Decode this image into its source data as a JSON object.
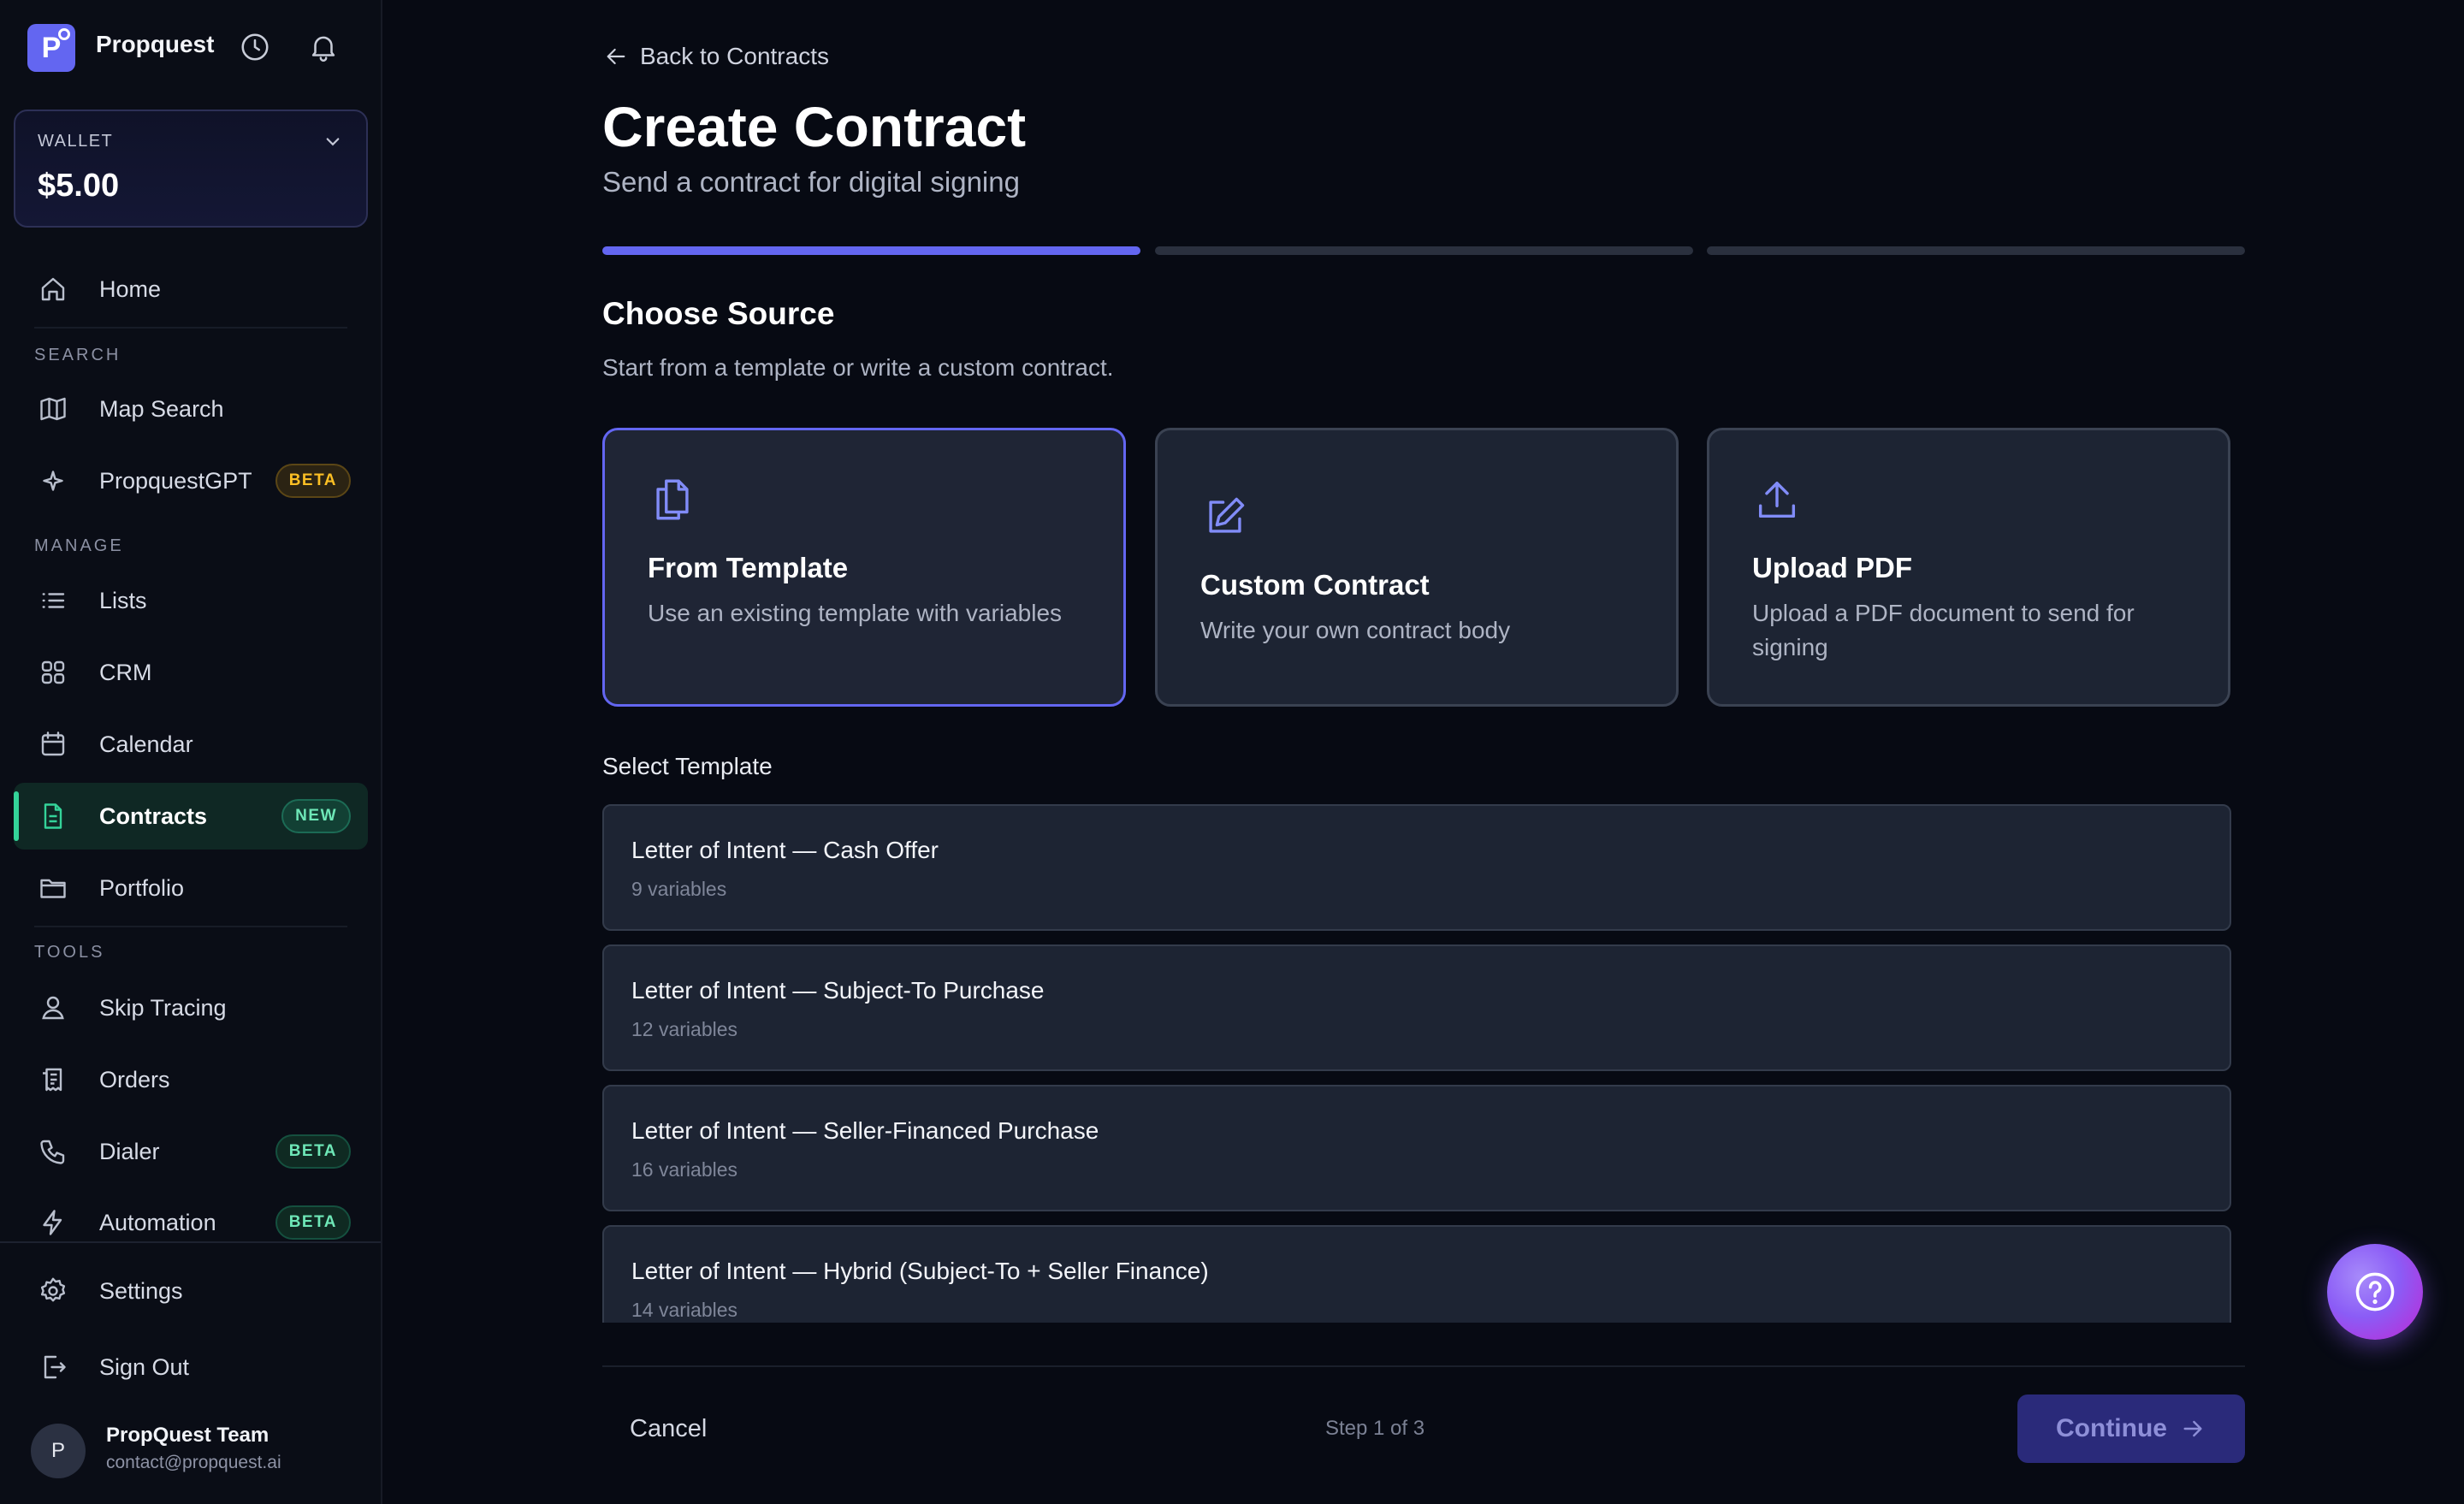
{
  "app": {
    "name": "Propquest",
    "logo_letter": "P"
  },
  "wallet": {
    "label": "WALLET",
    "value": "$5.00"
  },
  "nav": {
    "home": "Home",
    "section_search": "SEARCH",
    "map_search": "Map Search",
    "propquestgpt": "PropquestGPT",
    "propquestgpt_badge": "BETA",
    "section_manage": "MANAGE",
    "lists": "Lists",
    "crm": "CRM",
    "calendar": "Calendar",
    "contracts": "Contracts",
    "contracts_badge": "NEW",
    "portfolio": "Portfolio",
    "section_tools": "TOOLS",
    "skip_tracing": "Skip Tracing",
    "orders": "Orders",
    "dialer": "Dialer",
    "dialer_badge": "BETA",
    "automation": "Automation",
    "automation_badge": "BETA",
    "settings": "Settings",
    "sign_out": "Sign Out"
  },
  "user": {
    "initial": "P",
    "name": "PropQuest Team",
    "email": "contact@propquest.ai"
  },
  "page": {
    "back_label": "Back to Contracts",
    "title": "Create Contract",
    "subtitle": "Send a contract for digital signing",
    "progress": {
      "current_step": 1,
      "total_steps": 3
    }
  },
  "source": {
    "title": "Choose Source",
    "subtitle": "Start from a template or write a custom contract.",
    "options": [
      {
        "title": "From Template",
        "description": "Use an existing template with variables",
        "icon": "documents-icon",
        "selected": true
      },
      {
        "title": "Custom Contract",
        "description": "Write your own contract body",
        "icon": "pencil-square-icon",
        "selected": false
      },
      {
        "title": "Upload PDF",
        "description": "Upload a PDF document to send for signing",
        "icon": "upload-icon",
        "selected": false
      }
    ]
  },
  "templates": {
    "label": "Select Template",
    "items": [
      {
        "name": "Letter of Intent — Cash Offer",
        "variables": "9 variables"
      },
      {
        "name": "Letter of Intent — Subject-To Purchase",
        "variables": "12 variables"
      },
      {
        "name": "Letter of Intent — Seller-Financed Purchase",
        "variables": "16 variables"
      },
      {
        "name": "Letter of Intent — Hybrid (Subject-To + Seller Finance)",
        "variables": "14 variables"
      }
    ]
  },
  "footer": {
    "cancel": "Cancel",
    "step": "Step 1 of 3",
    "continue": "Continue"
  },
  "colors": {
    "accent": "#6366f1",
    "success": "#34d399",
    "background": "#070a13",
    "card": "#1d2433"
  }
}
